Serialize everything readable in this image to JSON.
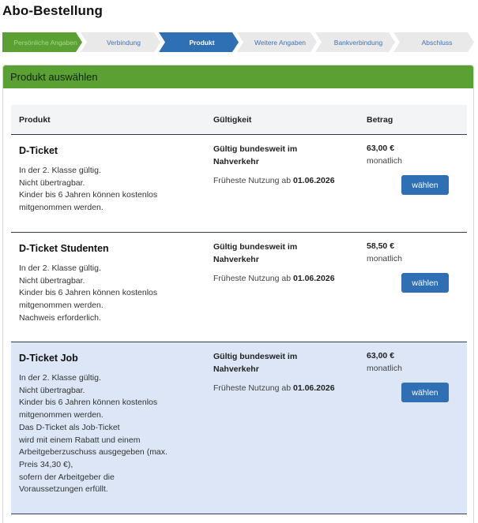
{
  "page": {
    "title": "Abo-Bestellung"
  },
  "steps": [
    {
      "label": "Persönliche Angaben",
      "state": "done"
    },
    {
      "label": "Verbindung",
      "state": "todo"
    },
    {
      "label": "Produkt",
      "state": "active"
    },
    {
      "label": "Weitere Angaben",
      "state": "todo"
    },
    {
      "label": "Bankverbindung",
      "state": "todo"
    },
    {
      "label": "Abschluss",
      "state": "todo"
    }
  ],
  "panel": {
    "title": "Produkt auswählen"
  },
  "table": {
    "headers": {
      "product": "Produkt",
      "validity": "Gültigkeit",
      "amount": "Betrag"
    },
    "rows": [
      {
        "name": "D-Ticket",
        "desc": [
          "In der 2. Klasse gültig.",
          "Nicht übertragbar.",
          "Kinder bis 6 Jahren können kostenlos",
          "mitgenommen werden."
        ],
        "validity": "Gültig bundesweit im Nahverkehr",
        "earliest_prefix": "Früheste Nutzung ab",
        "earliest_date": "01.06.2026",
        "price": "63,00 €",
        "period": "monatlich",
        "button": "wählen"
      },
      {
        "name": "D-Ticket Studenten",
        "desc": [
          "In der 2. Klasse gültig.",
          "Nicht übertragbar.",
          "Kinder bis 6 Jahren können kostenlos",
          "mitgenommen werden.",
          "Nachweis erforderlich."
        ],
        "validity": "Gültig bundesweit im Nahverkehr",
        "earliest_prefix": "Früheste Nutzung ab",
        "earliest_date": "01.06.2026",
        "price": "58,50 €",
        "period": "monatlich",
        "button": "wählen"
      },
      {
        "name": "D-Ticket Job",
        "desc": [
          "In der 2. Klasse gültig.",
          "Nicht übertragbar.",
          "Kinder bis 6 Jahren können kostenlos",
          "mitgenommen werden.",
          "Das D-Ticket als Job-Ticket",
          "wird mit einem Rabatt und einem",
          "Arbeitgeberzuschuss ausgegeben (max.",
          "Preis 34,30 €),",
          "sofern der Arbeitgeber die",
          "Voraussetzungen erfüllt."
        ],
        "validity": "Gültig bundesweit im Nahverkehr",
        "earliest_prefix": "Früheste Nutzung ab",
        "earliest_date": "01.06.2026",
        "price": "63,00 €",
        "period": "monatlich",
        "button": "wählen"
      }
    ]
  }
}
